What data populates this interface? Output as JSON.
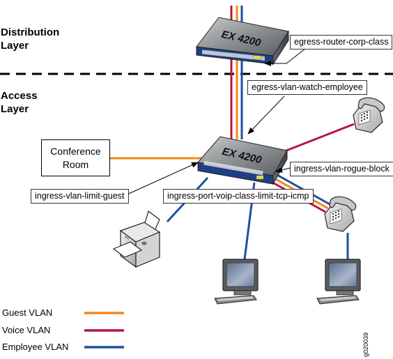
{
  "layers": {
    "distribution": [
      "Distribution",
      "Layer"
    ],
    "access": [
      "Access",
      "Layer"
    ]
  },
  "switches": {
    "distribution": {
      "model": "EX 4200"
    },
    "access": {
      "model": "EX 4200"
    }
  },
  "conference_room": [
    "Conference",
    "Room"
  ],
  "policy_labels": {
    "egress_router_corp_class": "egress-router-corp-class",
    "egress_vlan_watch_employee": "egress-vlan-watch-employee",
    "ingress_vlan_rogue_block": "ingress-vlan-rogue-block",
    "ingress_vlan_limit_guest": "ingress-vlan-limit-guest",
    "ingress_port_voip_class_limit_tcp_icmp": "ingress-port-voip-class-limit-tcp-icmp"
  },
  "legend": [
    {
      "label": "Guest VLAN",
      "color": "#f0891e"
    },
    {
      "label": "Voice VLAN",
      "color": "#b5173f"
    },
    {
      "label": "Employee VLAN",
      "color": "#1f4ea3"
    }
  ],
  "colors": {
    "guest": "#f0891e",
    "voice": "#b5173f",
    "employee": "#1f4ea3"
  },
  "figure_id": "g020039"
}
